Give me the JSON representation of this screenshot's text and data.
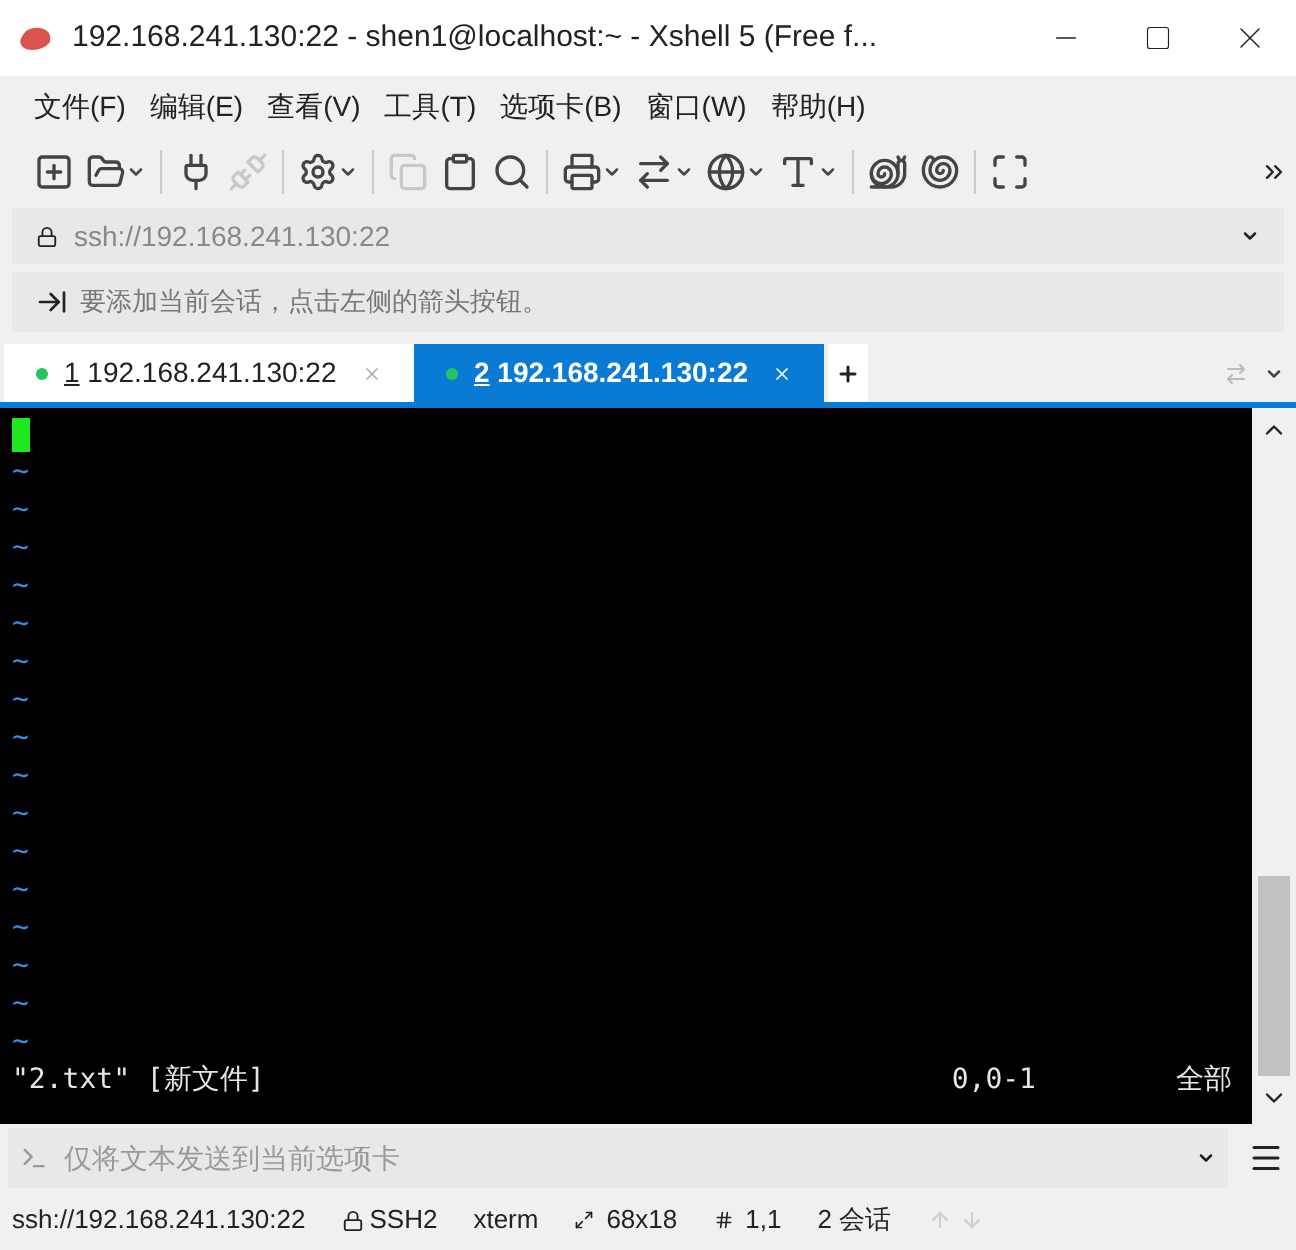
{
  "window": {
    "title": "192.168.241.130:22 - shen1@localhost:~ - Xshell 5 (Free f..."
  },
  "menu": [
    "文件(F)",
    "编辑(E)",
    "查看(V)",
    "工具(T)",
    "选项卡(B)",
    "窗口(W)",
    "帮助(H)"
  ],
  "toolbar": [
    {
      "dropdown": false,
      "disabled": false
    },
    {
      "dropdown": true,
      "disabled": false
    },
    {
      "dropdown": false,
      "disabled": false
    },
    {
      "dropdown": false,
      "disabled": true
    },
    {
      "dropdown": true,
      "disabled": false
    },
    {
      "dropdown": false,
      "disabled": true
    },
    {
      "dropdown": false,
      "disabled": false
    },
    {
      "dropdown": false,
      "disabled": false
    },
    {
      "dropdown": true,
      "disabled": false
    },
    {
      "dropdown": true,
      "disabled": false
    },
    {
      "dropdown": true,
      "disabled": false
    },
    {
      "dropdown": true,
      "disabled": false
    },
    {
      "dropdown": false,
      "disabled": false
    },
    {
      "dropdown": false,
      "disabled": false
    },
    {
      "dropdown": false,
      "disabled": false
    }
  ],
  "address": {
    "value": "ssh://192.168.241.130:22"
  },
  "hint": "要添加当前会话，点击左侧的箭头按钮。",
  "tabs": [
    {
      "number": "1",
      "label": " 192.168.241.130:22",
      "selected": false,
      "color": "#22c55e"
    },
    {
      "number": "2",
      "label": " 192.168.241.130:22",
      "selected": true,
      "color": "#22c55e"
    }
  ],
  "terminal": {
    "cursor": true,
    "lines": [
      "~",
      "~",
      "~",
      "~",
      "~",
      "~",
      "~",
      "~",
      "~",
      "~",
      "~",
      "~",
      "~",
      "~",
      "~",
      "~"
    ],
    "status_file": "\"2.txt\" [新文件]",
    "status_position": "0,0-1",
    "status_scope": "全部"
  },
  "send_bar": {
    "placeholder": "仅将文本发送到当前选项卡"
  },
  "status_bar": {
    "address": "ssh://192.168.241.130:22",
    "protocol": "SSH2",
    "terminal": "xterm",
    "size": "68x18",
    "cursor": "1,1",
    "sessions": "2 会话"
  }
}
